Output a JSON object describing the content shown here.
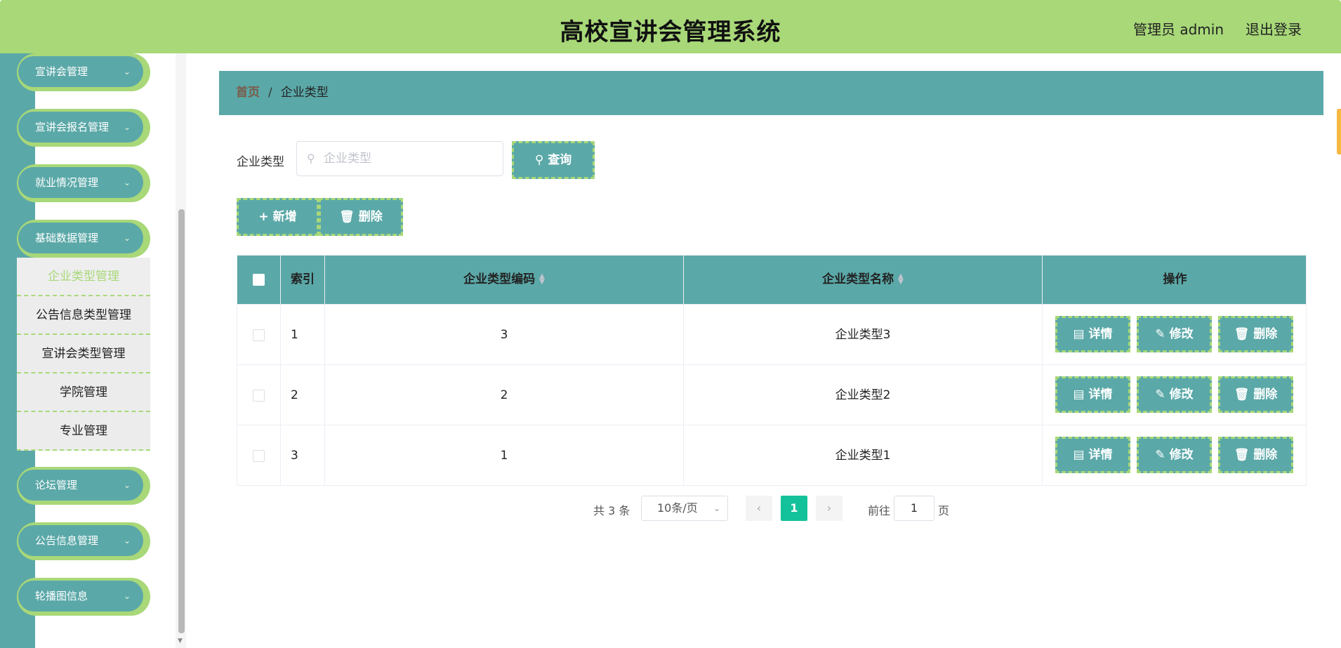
{
  "header": {
    "title": "高校宣讲会管理系统",
    "user": "管理员 admin",
    "logout": "退出登录"
  },
  "sidebar": {
    "menus": [
      {
        "label": "宣讲会管理"
      },
      {
        "label": "宣讲会报名管理"
      },
      {
        "label": "就业情况管理"
      },
      {
        "label": "基础数据管理"
      },
      {
        "label": "论坛管理"
      },
      {
        "label": "公告信息管理"
      },
      {
        "label": "轮播图信息"
      }
    ],
    "submenu": [
      {
        "label": "企业类型管理",
        "active": true
      },
      {
        "label": "公告信息类型管理"
      },
      {
        "label": "宣讲会类型管理"
      },
      {
        "label": "学院管理"
      },
      {
        "label": "专业管理"
      }
    ]
  },
  "breadcrumb": {
    "home": "首页",
    "separator": "/",
    "current": "企业类型"
  },
  "search": {
    "label": "企业类型",
    "placeholder": "企业类型",
    "value": "",
    "query_button": "查询"
  },
  "actions": {
    "add": "新增",
    "delete": "删除"
  },
  "table": {
    "headers": {
      "index": "索引",
      "code": "企业类型编码",
      "name": "企业类型名称",
      "ops": "操作"
    },
    "rows": [
      {
        "index": "1",
        "code": "3",
        "name": "企业类型3"
      },
      {
        "index": "2",
        "code": "2",
        "name": "企业类型2"
      },
      {
        "index": "3",
        "code": "1",
        "name": "企业类型1"
      }
    ],
    "row_buttons": {
      "detail": "详情",
      "edit": "修改",
      "delete": "删除"
    }
  },
  "pagination": {
    "total": "共 3 条",
    "page_size": "10条/页",
    "current_page": "1",
    "goto_label": "前往",
    "goto_value": "1",
    "page_suffix": "页"
  },
  "colors": {
    "header_bg": "#a8d878",
    "primary": "#5ba8a8",
    "active_page": "#13c29a"
  }
}
